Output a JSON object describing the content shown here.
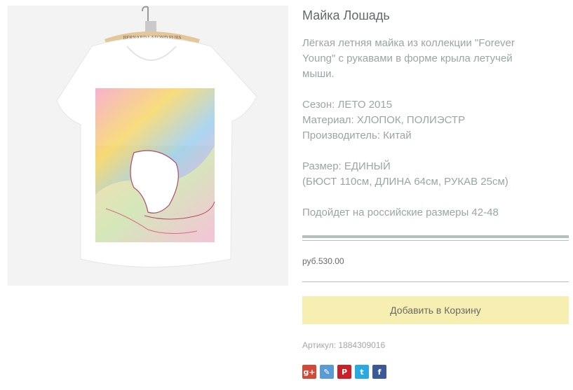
{
  "product": {
    "title": "Майка Лошадь",
    "description_lines": [
      "Лёгкая летняя майка из коллекции \"Forever",
      "Young\" с рукавами в форме крыла летучей",
      "мыши."
    ],
    "season": "Сезон: ЛЕТО 2015",
    "material": "Материал: ХЛОПОК, ПОЛИЭСТР",
    "manufacturer": "Производитель: Китай",
    "size": "Размер: ЕДИНЫЙ",
    "measurements": "(БЮСТ 110см, ДЛИНА 64см, РУКАВ 25см)",
    "fit_note": "Подойдет на российские размеры 42-48",
    "price": "руб.530.00",
    "add_to_cart_label": "Добавить в Корзину",
    "sku": "Артикул: 1884309016",
    "hanger_tag_text": "BERNARD LAFOND FURS"
  },
  "share": {
    "icons": [
      {
        "name": "google-plus-icon",
        "glyph": "g+",
        "color": "#d34836"
      },
      {
        "name": "livejournal-icon",
        "glyph": "✎",
        "color": "#5b9bd5"
      },
      {
        "name": "pinterest-icon",
        "glyph": "P",
        "color": "#cb2027"
      },
      {
        "name": "twitter-icon",
        "glyph": "t",
        "color": "#2aa9e0"
      },
      {
        "name": "facebook-icon",
        "glyph": "f",
        "color": "#3b5998"
      }
    ]
  },
  "colors": {
    "accent_button": "#f7eeb2",
    "rule": "#b3c0bc",
    "text_muted": "#9aa6a3"
  }
}
